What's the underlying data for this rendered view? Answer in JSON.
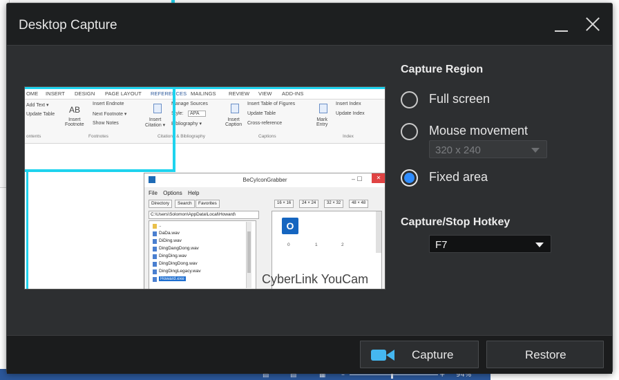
{
  "background": {
    "statusbar": {
      "zoom": "94%"
    }
  },
  "dialog": {
    "title": "Desktop Capture",
    "preview": {
      "ribbon_tabs": [
        "OME",
        "INSERT",
        "DESIGN",
        "PAGE LAYOUT",
        "REFERENCES",
        "MAILINGS",
        "REVIEW",
        "VIEW",
        "ADD-INS"
      ],
      "ribbon_items": {
        "add_text": "Add Text ▾",
        "update_table": "Update Table",
        "ab_label": "AB",
        "insert_footnote": "Insert\nFootnote",
        "insert_endnote": "Insert Endnote",
        "next_footnote": "Next Footnote ▾",
        "show_notes": "Show Notes",
        "insert_citation": "Insert\nCitation ▾",
        "manage_sources": "Manage Sources",
        "style_label": "Style:",
        "style_value": "APA",
        "bibliography": "Bibliography ▾",
        "insert_caption": "Insert\nCaption",
        "insert_table_figures": "Insert Table of Figures",
        "update_table2": "Update Table",
        "cross_reference": "Cross-reference",
        "mark_entry": "Mark\nEntry",
        "insert_index": "Insert Index",
        "update_index": "Update Index"
      },
      "ribbon_groups": [
        "ontents",
        "Footnotes",
        "Citations & Bibliography",
        "Captions",
        "Index"
      ],
      "subwindow": {
        "title": "BeCyIconGrabber",
        "minmax": "–  ☐",
        "close": "✕",
        "menu": [
          "File",
          "Options",
          "Help"
        ],
        "tabs": [
          "Directory",
          "Search",
          "Favorites"
        ],
        "path": "C:\\Users\\Solomon\\AppData\\Local\\Howard\\",
        "files": [
          "..",
          "DaDa.wav",
          "DiDing.wav",
          "DingDangDong.wav",
          "DingDing.wav",
          "DingDingDong.wav",
          "DingDingLegacy.wav",
          "Howard.exe"
        ],
        "size_tabs": [
          "16 × 16",
          "24 × 24",
          "32 × 32",
          "48 × 48"
        ],
        "grid_numbers": [
          "0",
          "1",
          "2"
        ],
        "outlook_letter": "O"
      },
      "watermark": "CyberLink YouCam"
    },
    "capture_region": {
      "title": "Capture Region",
      "options": [
        {
          "label": "Full screen",
          "checked": false
        },
        {
          "label": "Mouse movement",
          "checked": false
        },
        {
          "label": "Fixed area",
          "checked": true
        }
      ],
      "size_value": "320 x 240"
    },
    "hotkey": {
      "title": "Capture/Stop Hotkey",
      "value": "F7"
    },
    "buttons": {
      "capture": "Capture",
      "restore": "Restore"
    },
    "colors": {
      "accent": "#2f8dff",
      "selection_outline": "#1ed3ee",
      "camera_icon": "#45b7f0"
    }
  }
}
